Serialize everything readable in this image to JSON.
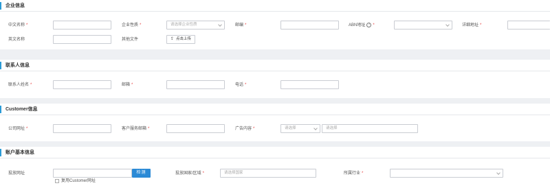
{
  "sections": {
    "enterprise": {
      "title": "企业信息",
      "fields": {
        "chinese_name": "中文名称",
        "company_nature": "企业性质",
        "company_nature_placeholder": "请选择企业性质",
        "zip": "邮编",
        "abn": "ABN地址",
        "detail_address": "详细地址",
        "english_name": "英文名称",
        "other_files": "其他文件",
        "upload_label": "点击上传"
      }
    },
    "contact": {
      "title": "联系人信息",
      "fields": {
        "contact_name": "联系人姓名",
        "email": "邮箱",
        "phone": "电话"
      }
    },
    "customer": {
      "title": "Customer信息",
      "fields": {
        "company_url": "公司网址",
        "customer_service_email": "客户服务邮箱",
        "ad_content": "广告内容",
        "select_placeholder_1": "请选择",
        "select_placeholder_2": "请选择"
      }
    },
    "account": {
      "title": "账户基本信息",
      "fields": {
        "ad_url": "投放网址",
        "detect_button": "检测",
        "country_region": "投放国家/区域",
        "country_placeholder": "请选择国家",
        "industry": "所属行业",
        "reuse_customer_url": "复用Customer网址"
      }
    }
  },
  "required_mark": "*",
  "colors": {
    "accent": "#2b9bd6",
    "required": "#e53e3e",
    "button": "#2b8ad6"
  }
}
